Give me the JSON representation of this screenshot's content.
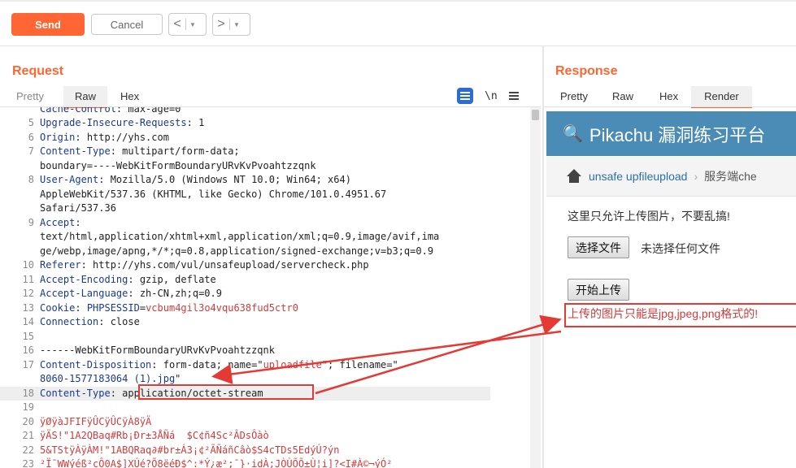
{
  "toolbar": {
    "send_label": "Send",
    "cancel_label": "Cancel",
    "back_arrow": "<",
    "forward_arrow": ">",
    "dropdown_glyph": "▼"
  },
  "request": {
    "title": "Request",
    "tabs": [
      "Pretty",
      "Raw",
      "Hex"
    ],
    "active_tab": "Raw",
    "newline_toggle": "\\n",
    "lines": [
      {
        "n": "",
        "k": "Cache-Control",
        "sep": ": ",
        "v": "max-age=0",
        "partial": true
      },
      {
        "n": "5",
        "k": "Upgrade-Insecure-Requests",
        "sep": ": ",
        "v": "1"
      },
      {
        "n": "6",
        "k": "Origin",
        "sep": ": ",
        "v": "http://yhs.com"
      },
      {
        "n": "7",
        "k": "Content-Type",
        "sep": ": ",
        "v": "multipart/form-data;"
      },
      {
        "n": "",
        "k": "",
        "sep": "",
        "v": "boundary=----WebKitFormBoundaryURvKvPvoahtzzqnk"
      },
      {
        "n": "8",
        "k": "User-Agent",
        "sep": ": ",
        "v": "Mozilla/5.0 (Windows NT 10.0; Win64; x64)"
      },
      {
        "n": "",
        "k": "",
        "sep": "",
        "v": "AppleWebKit/537.36 (KHTML, like Gecko) Chrome/101.0.4951.67"
      },
      {
        "n": "",
        "k": "",
        "sep": "",
        "v": "Safari/537.36"
      },
      {
        "n": "9",
        "k": "Accept",
        "sep": ":",
        "v": ""
      },
      {
        "n": "",
        "k": "",
        "sep": "",
        "v": "text/html,application/xhtml+xml,application/xml;q=0.9,image/avif,ima"
      },
      {
        "n": "",
        "k": "",
        "sep": "",
        "v": "ge/webp,image/apng,*/*;q=0.8,application/signed-exchange;v=b3;q=0.9"
      },
      {
        "n": "10",
        "k": "Referer",
        "sep": ": ",
        "v": "http://yhs.com/vul/unsafeupload/servercheck.php"
      },
      {
        "n": "11",
        "k": "Accept-Encoding",
        "sep": ": ",
        "v": "gzip, deflate"
      },
      {
        "n": "12",
        "k": "Accept-Language",
        "sep": ": ",
        "v": "zh-CN,zh;q=0.9"
      },
      {
        "n": "13",
        "k": "Cookie",
        "sep": ": ",
        "v": "",
        "ck": "PHPSESSID",
        "cv": "vcbum4gil3o4vqu638fud5ctr0"
      },
      {
        "n": "14",
        "k": "Connection",
        "sep": ": ",
        "v": "close"
      },
      {
        "n": "15",
        "k": "",
        "sep": "",
        "v": ""
      },
      {
        "n": "16",
        "k": "",
        "sep": "",
        "v": "------WebKitFormBoundaryURvKvPvoahtzzqnk"
      },
      {
        "n": "17",
        "k": "Content-Disposition",
        "sep": ": ",
        "v": "form-data; name=\"",
        "q1": "uploadfile",
        "mid": "\"; filename=\""
      },
      {
        "n": "",
        "k": "",
        "sep": "",
        "v": "",
        "fname": "8060-1577183064 (1).jpg",
        "tail": "\""
      },
      {
        "n": "18",
        "k": "Content-Type",
        "sep": ": ",
        "v": "application/octet-stream",
        "hl": true
      },
      {
        "n": "19",
        "k": "",
        "sep": "",
        "v": ""
      },
      {
        "n": "20",
        "k": "",
        "sep": "",
        "v": "ÿØÿàJFIFÿÛCÿÛCÿÀ\u0011\b\u00118ÿÄ",
        "junk": true
      },
      {
        "n": "21",
        "k": "",
        "sep": "",
        "v": "ÿÄS!\"1A2QBaq#Rb\u0011\u0011¡Ðr±3ÅÑá  $C\u0011¢ñ4Sc²Â\u0012\u0011Ds\u0012Ôàò",
        "junk": true
      },
      {
        "n": "22",
        "k": "",
        "sep": "",
        "v": "5&TStÿÀÿÀM!\"1ABQRaq∂#br\u0011±Á3\u0011\u0011\u0011¡¢²ÃÑ\u0011áñCâò$S4cTD\u0011s5EdýÚ?ýn",
        "junk": true
      },
      {
        "n": "23",
        "k": "",
        "sep": "",
        "v": "²Ï¯WWýé\u0011ß²cÔ0A$]XÚé\u0011?Õ8ëé\u0011Ð$^:*Ý¿æ²\u0011;\u0011¯}·idÀ\u0011;J\u0011ÒÙÕÕ\u0011±Ù¦i]?<I#À©¬ýÓ²",
        "junk": true
      }
    ]
  },
  "response": {
    "title": "Response",
    "tabs": [
      "Pretty",
      "Raw",
      "Hex",
      "Render"
    ],
    "active_tab": "Render",
    "render": {
      "site_title": "Pikachu 漏洞练习平台",
      "breadcrumb_link": "unsafe upfileupload",
      "breadcrumb_current": "服务端che",
      "notice": "这里只允许上传图片，不要乱搞!",
      "choose_file_button": "选择文件",
      "no_file_text": "未选择任何文件",
      "upload_button": "开始上传",
      "error_message": "上传的图片只能是jpg,jpeg,png格式的!"
    }
  },
  "colors": {
    "accent": "#ff6633",
    "header_blue": "#4a8cb5",
    "annotation_red": "#e53935",
    "link_blue": "#2c6fa8"
  },
  "icons": [
    "key-icon",
    "home-icon",
    "wrap-lines-icon",
    "menu-icon",
    "chevron-down-icon"
  ]
}
